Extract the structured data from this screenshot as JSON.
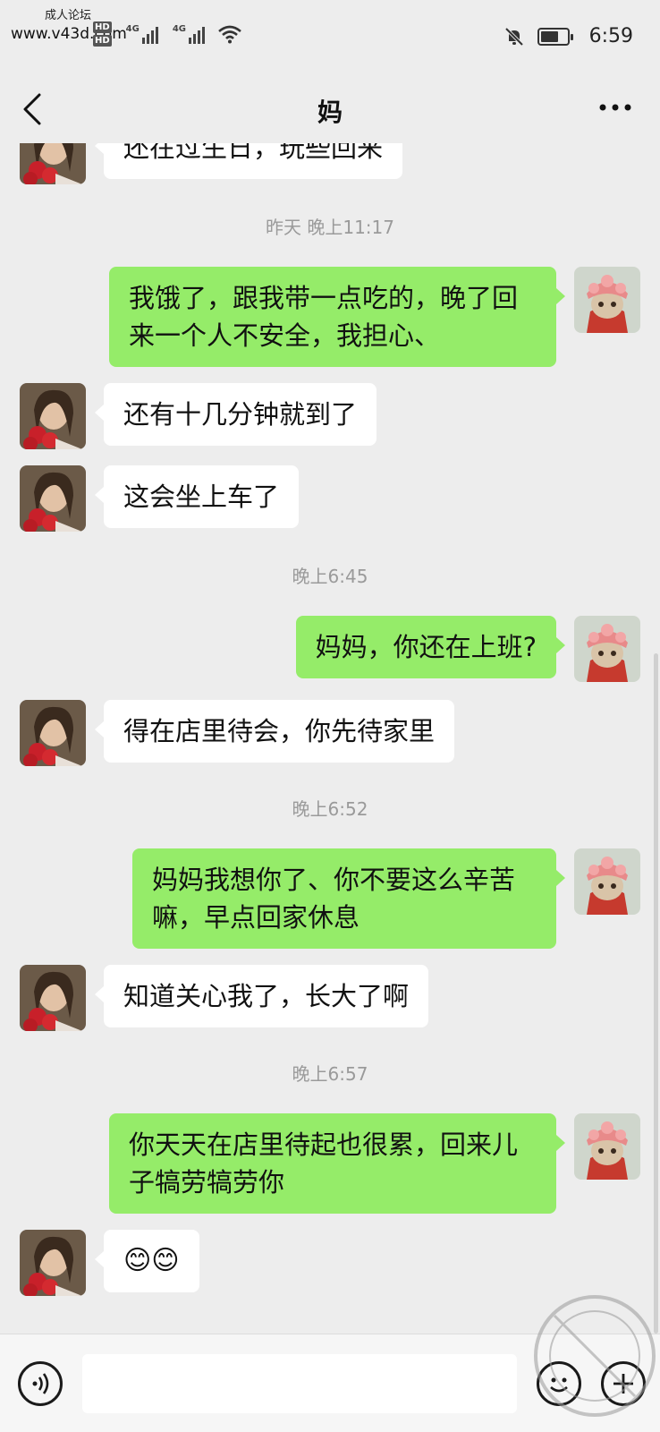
{
  "status_bar": {
    "watermark_small": "成人论坛",
    "watermark_url": "www.v43d.com",
    "network_label_1": "4G",
    "network_label_2": "4G",
    "hd_tag_1": "HD",
    "hd_tag_2": "HD",
    "time": "6:59"
  },
  "header": {
    "title": "妈"
  },
  "messages": [
    {
      "sender": "mom",
      "text": "还在过生日，玩些回来"
    },
    {
      "type": "timestamp",
      "text": "昨天 晚上11:17"
    },
    {
      "sender": "me",
      "line1": "我饿了，跟我带一点吃的，晚了回",
      "line2": "来一个人不安全，我担心、"
    },
    {
      "sender": "mom",
      "text": "还有十几分钟就到了"
    },
    {
      "sender": "mom",
      "text": "这会坐上车了"
    },
    {
      "type": "timestamp",
      "text": "晚上6:45"
    },
    {
      "sender": "me",
      "text": "妈妈，你还在上班?"
    },
    {
      "sender": "mom",
      "text": "得在店里待会，你先待家里"
    },
    {
      "type": "timestamp",
      "text": "晚上6:52"
    },
    {
      "sender": "me",
      "line1": "妈妈我想你了、你不要这么辛苦",
      "line2": "嘛，早点回家休息"
    },
    {
      "sender": "mom",
      "text": "知道关心我了，长大了啊"
    },
    {
      "type": "timestamp",
      "text": "晚上6:57"
    },
    {
      "sender": "me",
      "line1": "你天天在店里待起也很累，回来儿",
      "line2": "子犒劳犒劳你"
    },
    {
      "sender": "mom",
      "text": "😊😊"
    }
  ],
  "input_bar": {
    "placeholder": ""
  },
  "colors": {
    "background": "#ededed",
    "my_bubble": "#95ec69",
    "mom_bubble": "#ffffff",
    "timestamp": "#9a9a9a"
  },
  "icons": [
    "back-icon",
    "more-icon",
    "voice-icon",
    "emoji-icon",
    "plus-icon",
    "mute-icon",
    "battery-icon",
    "wifi-icon",
    "signal-icon"
  ]
}
